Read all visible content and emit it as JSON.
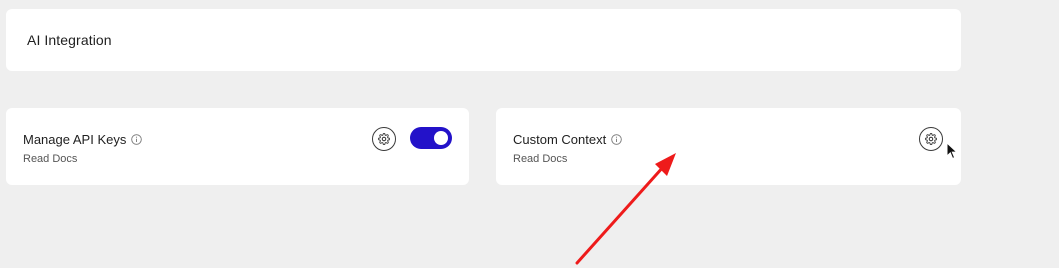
{
  "header": {
    "title": "AI Integration"
  },
  "features": [
    {
      "title": "Manage API Keys",
      "link": "Read Docs",
      "enabled": true
    },
    {
      "title": "Custom Context",
      "link": "Read Docs"
    }
  ],
  "icons": {
    "info": "info-icon",
    "settings": "gear-icon",
    "cursor": "mouse-pointer-icon"
  },
  "colors": {
    "background": "#efefef",
    "card": "#ffffff",
    "toggle_on": "#2312c9",
    "annotation": "#ee1b1b"
  }
}
